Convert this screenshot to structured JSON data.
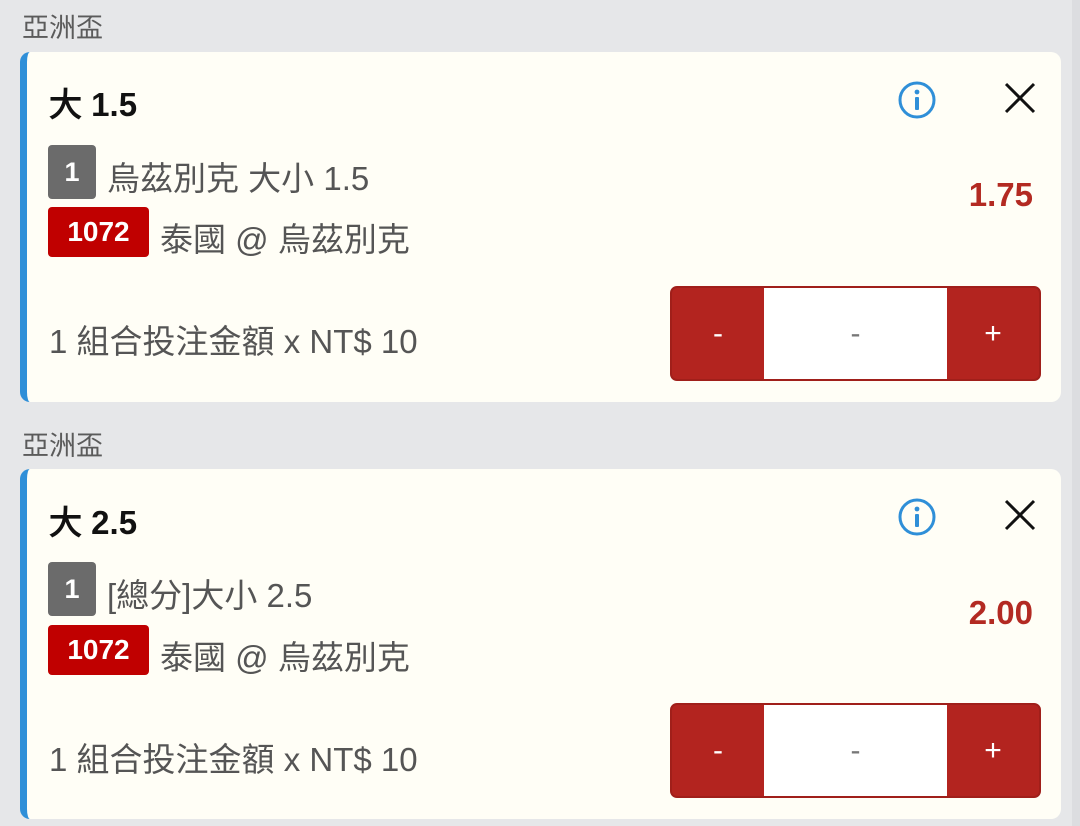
{
  "slips": [
    {
      "section": "亞洲盃",
      "title": "大 1.5",
      "leg_number": "1",
      "market": "烏茲別克 大小 1.5",
      "match_id": "1072",
      "match": "泰國 @ 烏茲別克",
      "odds": "1.75",
      "stake_text": "1 組合投注金額 x NT$ 10",
      "stepper": {
        "minus": "-",
        "value": "-",
        "plus": "+"
      }
    },
    {
      "section": "亞洲盃",
      "title": "大 2.5",
      "leg_number": "1",
      "market": "[總分]大小 2.5",
      "match_id": "1072",
      "match": "泰國 @ 烏茲別克",
      "odds": "2.00",
      "stake_text": "1 組合投注金額 x NT$ 10",
      "stepper": {
        "minus": "-",
        "value": "-",
        "plus": "+"
      }
    }
  ],
  "icons": {
    "info": "info-icon",
    "close": "close-icon"
  },
  "colors": {
    "accent_blue": "#2f8fd8",
    "odds_red": "#b32a22",
    "badge_red": "#c00000",
    "stepper_red": "#b3241f"
  }
}
